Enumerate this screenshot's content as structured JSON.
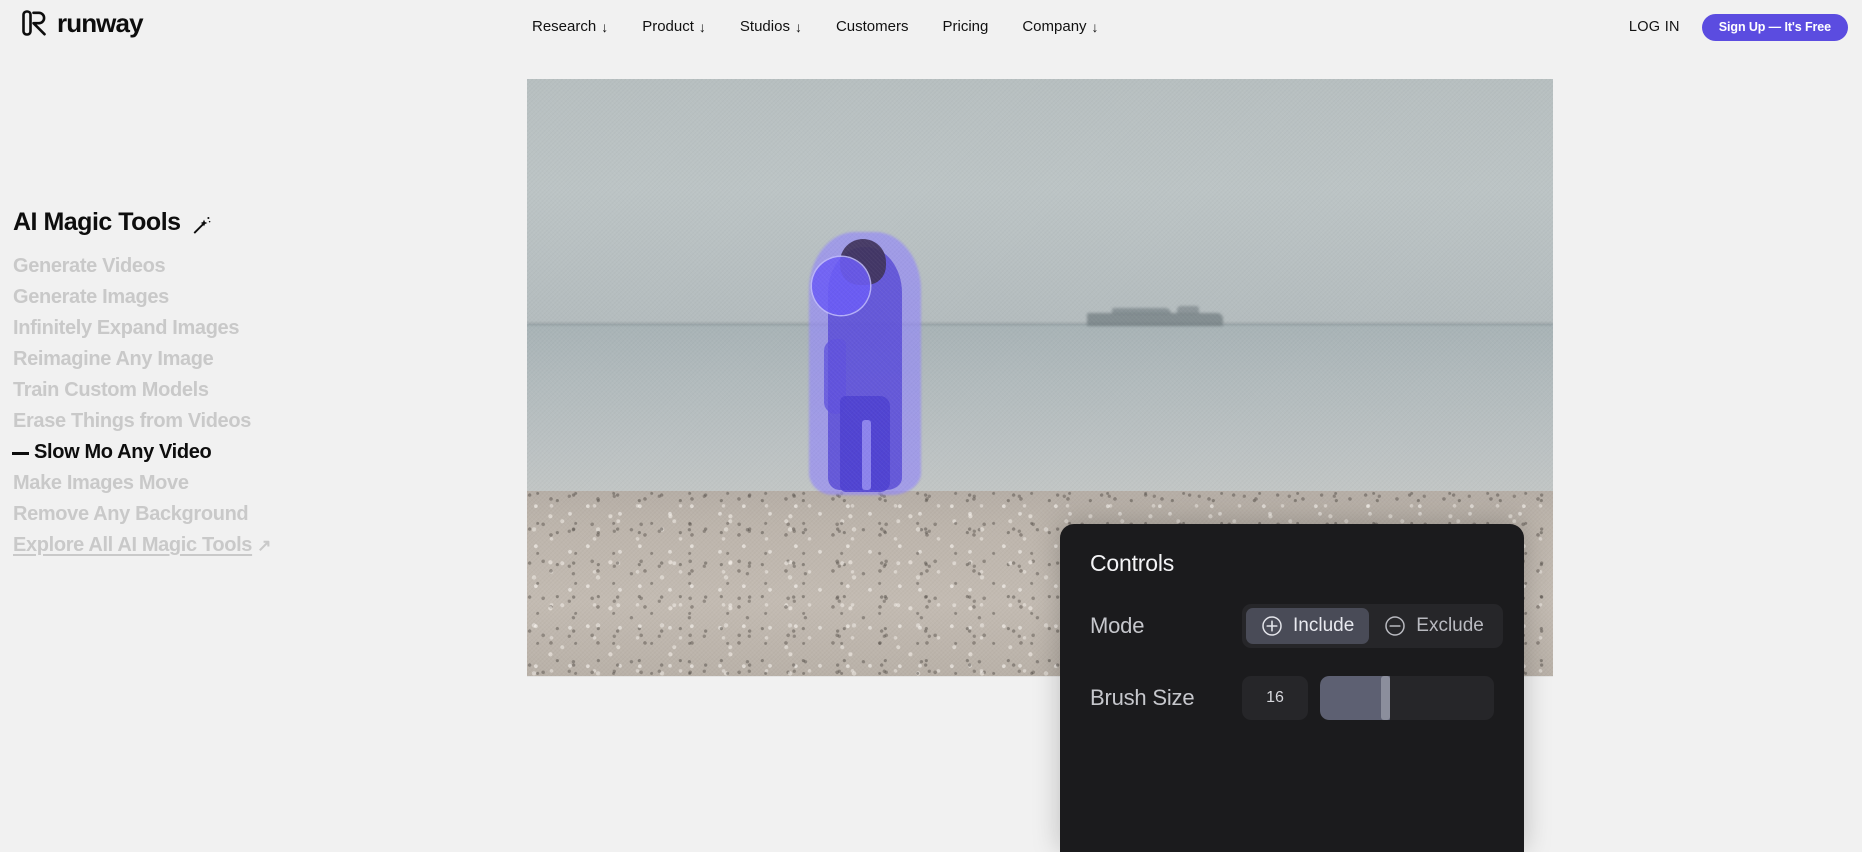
{
  "brand": {
    "name": "runway",
    "logo_icon": "runway-logo-icon"
  },
  "nav": {
    "links": [
      {
        "label": "Research",
        "caret": "↓"
      },
      {
        "label": "Product",
        "caret": "↓"
      },
      {
        "label": "Studios",
        "caret": "↓"
      },
      {
        "label": "Customers",
        "caret": ""
      },
      {
        "label": "Pricing",
        "caret": ""
      },
      {
        "label": "Company",
        "caret": "↓"
      }
    ],
    "login_label": "LOG IN",
    "signup_label": "Sign Up — It's Free",
    "signup_color": "#5b4ce0"
  },
  "sidebar": {
    "title": "AI Magic Tools",
    "title_icon": "magic-wand-icon",
    "items": [
      {
        "label": "Generate Videos",
        "active": false
      },
      {
        "label": "Generate Images",
        "active": false
      },
      {
        "label": "Infinitely Expand Images",
        "active": false
      },
      {
        "label": "Reimagine Any Image",
        "active": false
      },
      {
        "label": "Train Custom Models",
        "active": false
      },
      {
        "label": "Erase Things from Videos",
        "active": false
      },
      {
        "label": "Slow Mo Any Video",
        "active": true
      },
      {
        "label": "Make Images Move",
        "active": false
      },
      {
        "label": "Remove Any Background",
        "active": false
      }
    ],
    "explore_label": "Explore All AI Magic Tools",
    "explore_arrow": "↗"
  },
  "stage": {
    "scene": "beach-ocean-person",
    "mask_color": "#5648d6",
    "mask_halo_color": "#968cf5",
    "brush_cursor_color": "#6c5cf6"
  },
  "controls": {
    "title": "Controls",
    "mode": {
      "label": "Mode",
      "options": [
        {
          "label": "Include",
          "icon": "plus-circle-icon",
          "selected": true
        },
        {
          "label": "Exclude",
          "icon": "minus-circle-icon",
          "selected": false
        }
      ]
    },
    "brush_size": {
      "label": "Brush Size",
      "value": "16",
      "fill_percent": 40
    }
  }
}
